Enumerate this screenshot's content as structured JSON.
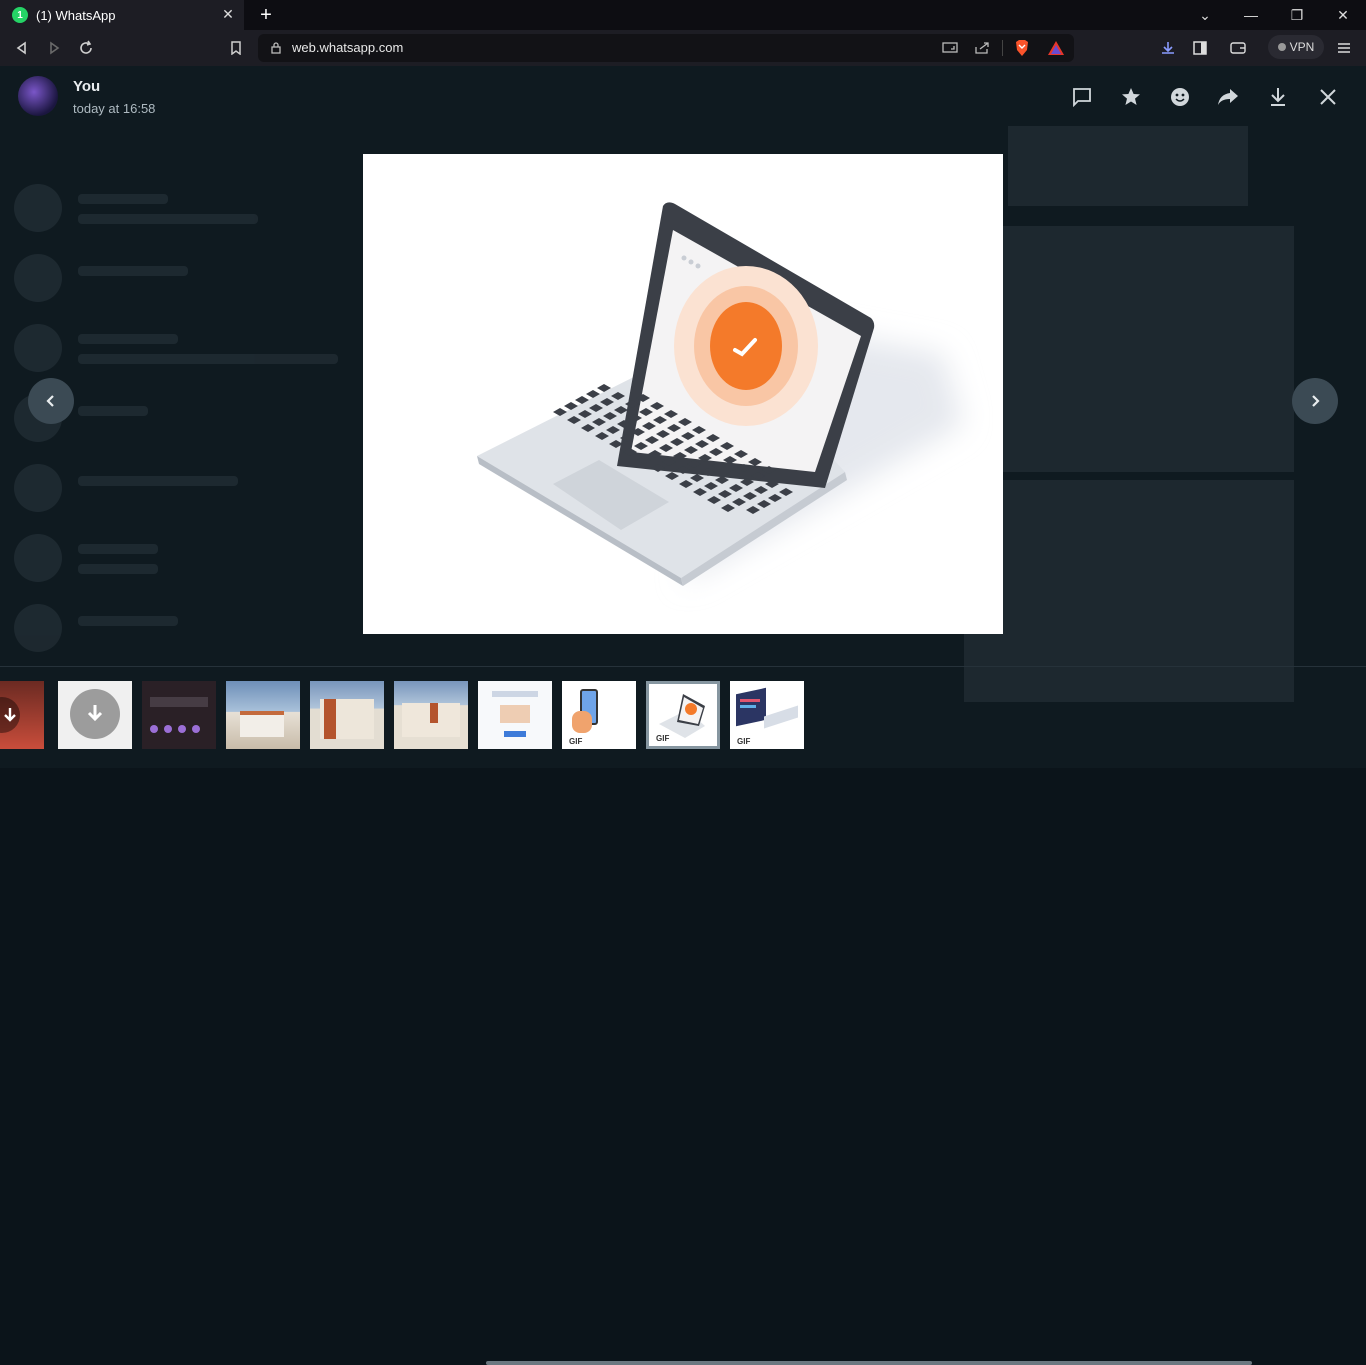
{
  "browser": {
    "tab_title": "(1) WhatsApp",
    "tab_badge": "1",
    "url": "web.whatsapp.com",
    "vpn_label": "VPN"
  },
  "viewer": {
    "sender": "You",
    "timestamp": "today at 16:58",
    "gif_label": "GIF"
  },
  "colors": {
    "accent": "#25d366",
    "viewer_bg": "#0f1a20",
    "illustration_orange": "#f47a2a"
  }
}
